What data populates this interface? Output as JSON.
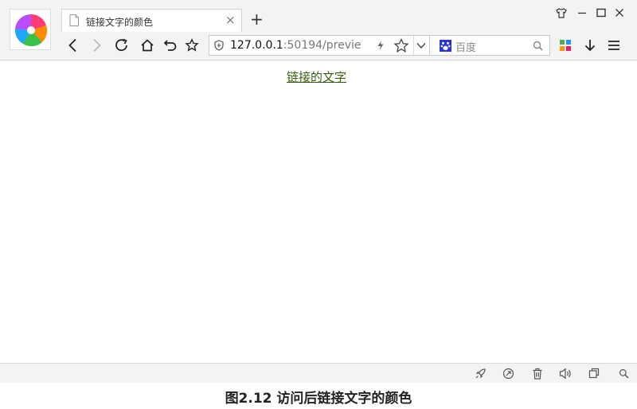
{
  "tab": {
    "title": "链接文字的颜色"
  },
  "address_bar": {
    "host": "127.0.0.1",
    "rest": ":50194/previe"
  },
  "search_bar": {
    "placeholder": "百度"
  },
  "content": {
    "link_text": "链接的文字"
  },
  "caption": "图2.12  访问后链接文字的颜色",
  "colors": {
    "visited_link": "#3a5d0f",
    "chrome_bg": "#f3f3f3"
  }
}
